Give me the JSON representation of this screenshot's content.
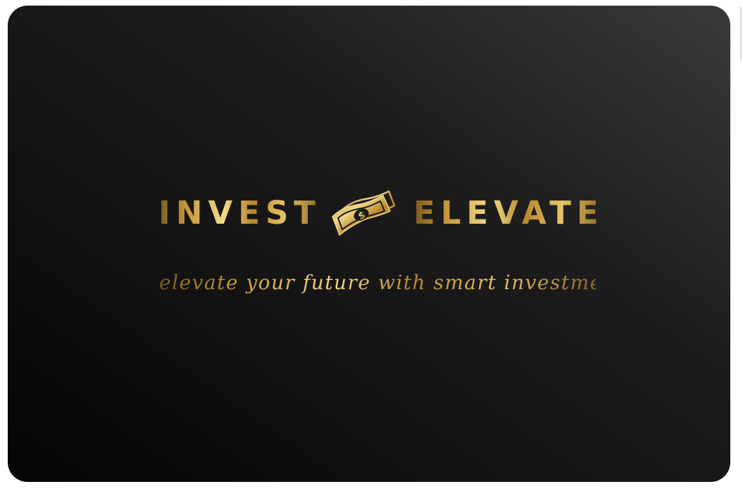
{
  "logo": {
    "word_left": "INVEST",
    "word_right": "ELEVATE",
    "tagline": "elevate your future with smart investments",
    "icon": "money-bill-icon"
  },
  "colors": {
    "background_dark": "#0a0a0a",
    "background_light": "#3a3a3a",
    "gold_light": "#f3d98a",
    "gold_mid": "#c99a3c",
    "gold_dark": "#7a5a1e",
    "page": "#ffffff"
  }
}
